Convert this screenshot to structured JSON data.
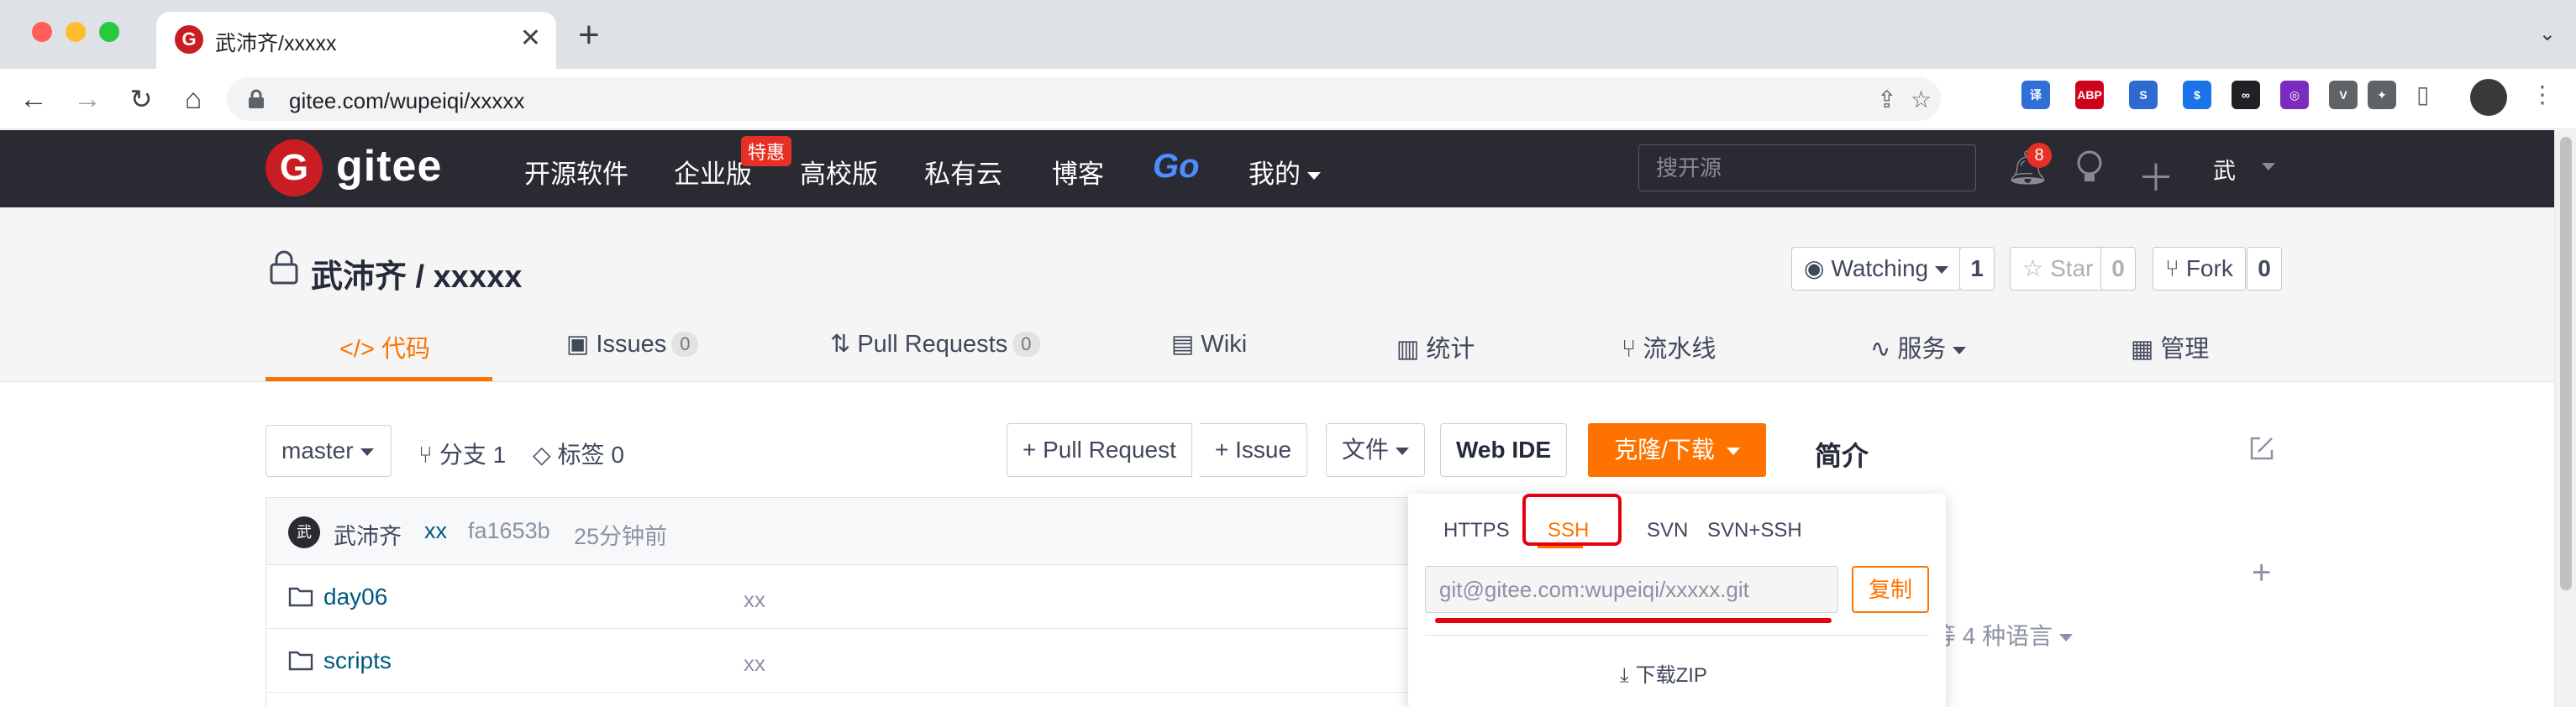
{
  "browser": {
    "tab_title": "武沛齐/xxxxx",
    "tab_favicon": "G",
    "url": "gitee.com/wupeiqi/xxxxx",
    "new_tab": "+",
    "extensions": [
      {
        "name": "translate-extension-icon",
        "label": "译",
        "color": "#2f6fd6"
      },
      {
        "name": "adblock-extension-icon",
        "label": "ABP",
        "color": "#d0021b"
      },
      {
        "name": "s-extension-icon",
        "label": "S",
        "color": "#2d6bd1"
      },
      {
        "name": "wallet-extension-icon",
        "label": "$",
        "color": "#1a73e8"
      },
      {
        "name": "link-extension-icon",
        "label": "∞",
        "color": "#202124"
      },
      {
        "name": "color-extension-icon",
        "label": "◎",
        "color": "#7b2cbf"
      },
      {
        "name": "v-extension-icon",
        "label": "V",
        "color": "#5f6368"
      },
      {
        "name": "puzzle-extension-icon",
        "label": "✦",
        "color": "#5f6368"
      }
    ]
  },
  "site": {
    "logo_text": "gitee",
    "nav": [
      "开源软件",
      "企业版",
      "高校版",
      "私有云",
      "博客"
    ],
    "nav_go": "Go",
    "nav_mine": "我的",
    "badge_tehui": "特惠",
    "search_placeholder": "搜开源",
    "notification_count": "8",
    "user_initial": "武"
  },
  "repo": {
    "title": "武沛齐 / xxxxx",
    "watch_label": "Watching",
    "watch_count": "1",
    "star_label": "Star",
    "star_count": "0",
    "fork_label": "Fork",
    "fork_count": "0",
    "tabs": [
      {
        "label": "代码"
      },
      {
        "label": "Issues",
        "count": "0"
      },
      {
        "label": "Pull Requests",
        "count": "0"
      },
      {
        "label": "Wiki"
      },
      {
        "label": "统计"
      },
      {
        "label": "流水线"
      },
      {
        "label": "服务"
      },
      {
        "label": "管理"
      }
    ]
  },
  "toolbar": {
    "branch": "master",
    "branches": "分支 1",
    "tags": "标签 0",
    "pull_request": "+ Pull Request",
    "issue": "+ Issue",
    "file": "文件",
    "web_ide": "Web IDE",
    "clone": "克隆/下载"
  },
  "commit": {
    "avatar": "武",
    "author": "武沛齐",
    "message": "xx",
    "hash": "fa1653b",
    "time": "25分钟前"
  },
  "files": [
    {
      "name": "day06",
      "message": "xx"
    },
    {
      "name": "scripts",
      "message": "xx"
    }
  ],
  "sidebar": {
    "intro_title": "简介",
    "plus": "+",
    "languages": "等 4 种语言"
  },
  "clone_panel": {
    "protocols": [
      "HTTPS",
      "SSH",
      "SVN",
      "SVN+SSH"
    ],
    "active_protocol": "SSH",
    "url": "git@gitee.com:wupeiqi/xxxxx.git",
    "copy_label": "复制",
    "download_zip": "下载ZIP"
  },
  "colors": {
    "accent": "#fe7300",
    "header_bg": "#2a2a32",
    "annotation_red": "#e60012"
  }
}
